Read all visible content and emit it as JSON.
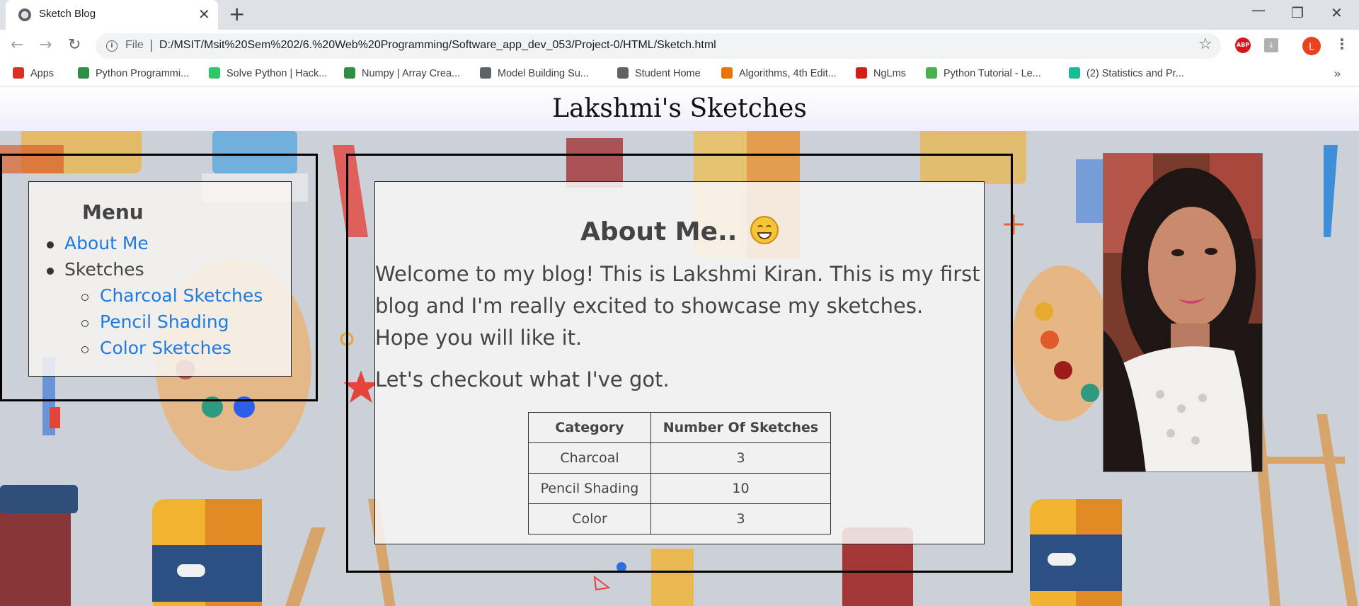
{
  "browser": {
    "tab_title": "Sketch Blog",
    "new_tab_symbol": "+",
    "close_symbol": "✕",
    "url_scheme": "File",
    "url": "D:/MSIT/Msit%20Sem%202/6.%20Web%20Programming/Software_app_dev_053/Project-0/HTML/Sketch.html",
    "profile_initial": "L",
    "abp_label": "ABP",
    "bookmarks": [
      {
        "label": "Apps",
        "icon": "apps-grid-icon",
        "color": "#d93025"
      },
      {
        "label": "Python Programmi...",
        "icon": "geeksforgeeks-icon",
        "color": "#2f8d46"
      },
      {
        "label": "Solve Python | Hack...",
        "icon": "hackerrank-icon",
        "color": "#2ec866"
      },
      {
        "label": "Numpy | Array Crea...",
        "icon": "geeksforgeeks-icon",
        "color": "#2f8d46"
      },
      {
        "label": "Model Building Su...",
        "icon": "bike-icon",
        "color": "#5f6368"
      },
      {
        "label": "Student Home",
        "icon": "globe-icon",
        "color": "#5f6368"
      },
      {
        "label": "Algorithms, 4th Edit...",
        "icon": "princeton-shield-icon",
        "color": "#e77500"
      },
      {
        "label": "NgLms",
        "icon": "angular-icon",
        "color": "#dd1b16"
      },
      {
        "label": "Python Tutorial - Le...",
        "icon": "b-logo-icon",
        "color": "#4caf50"
      },
      {
        "label": "(2) Statistics and Pr...",
        "icon": "khan-academy-icon",
        "color": "#14bf96"
      }
    ]
  },
  "page": {
    "title": "Lakshmi's Sketches",
    "menu": {
      "heading": "Menu",
      "about": "About Me",
      "sketches": "Sketches",
      "sub_items": [
        "Charcoal Sketches",
        "Pencil Shading",
        "Color Sketches"
      ]
    },
    "about": {
      "heading": "About Me..",
      "welcome": "Welcome to my blog! This is Lakshmi Kiran. This is my first blog and I'm really excited to showcase my sketches. Hope you will like it.",
      "checkout": "Let's checkout what I've got."
    },
    "table": {
      "headers": [
        "Category",
        "Number Of Sketches"
      ],
      "rows": [
        [
          "Charcoal",
          "3"
        ],
        [
          "Pencil Shading",
          "10"
        ],
        [
          "Color",
          "3"
        ]
      ]
    }
  },
  "colors": {
    "link": "#1d7be0",
    "text": "#444444"
  }
}
